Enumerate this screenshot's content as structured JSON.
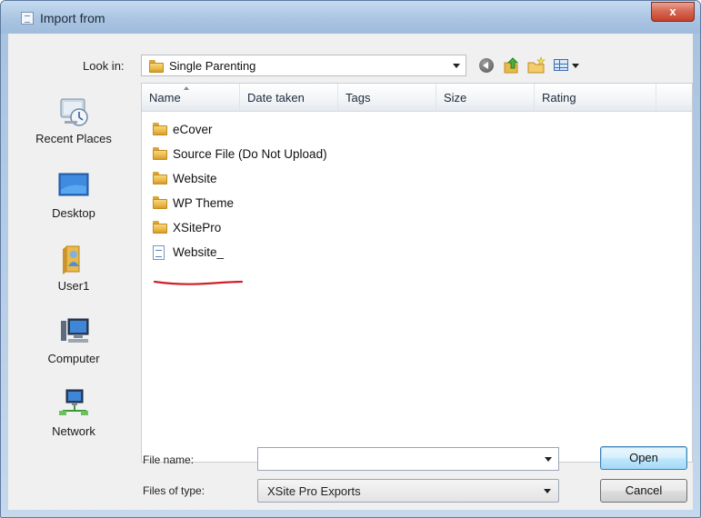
{
  "window": {
    "title": "Import from",
    "close_label": "x"
  },
  "toolbar": {
    "lookin_label": "Look in:",
    "lookin_value": "Single Parenting"
  },
  "places": [
    {
      "label": "Recent Places",
      "icon": "recent-places-icon"
    },
    {
      "label": "Desktop",
      "icon": "desktop-icon"
    },
    {
      "label": "User1",
      "icon": "user-folder-icon"
    },
    {
      "label": "Computer",
      "icon": "computer-icon"
    },
    {
      "label": "Network",
      "icon": "network-icon"
    }
  ],
  "columns": [
    "Name",
    "Date taken",
    "Tags",
    "Size",
    "Rating"
  ],
  "files": [
    {
      "name": "eCover",
      "type": "folder"
    },
    {
      "name": "Source File (Do Not Upload)",
      "type": "folder"
    },
    {
      "name": "Website",
      "type": "folder"
    },
    {
      "name": "WP Theme",
      "type": "folder"
    },
    {
      "name": "XSitePro",
      "type": "folder"
    },
    {
      "name": "Website_",
      "type": "file"
    }
  ],
  "form": {
    "filename_label": "File name:",
    "filename_value": "",
    "filetype_label": "Files of type:",
    "filetype_value": "XSite Pro Exports"
  },
  "buttons": {
    "open": "Open",
    "cancel": "Cancel"
  },
  "colors": {
    "annotation_underline": "#d0202a",
    "folder": "#e9b949",
    "title_bar": "#aac4e2"
  }
}
